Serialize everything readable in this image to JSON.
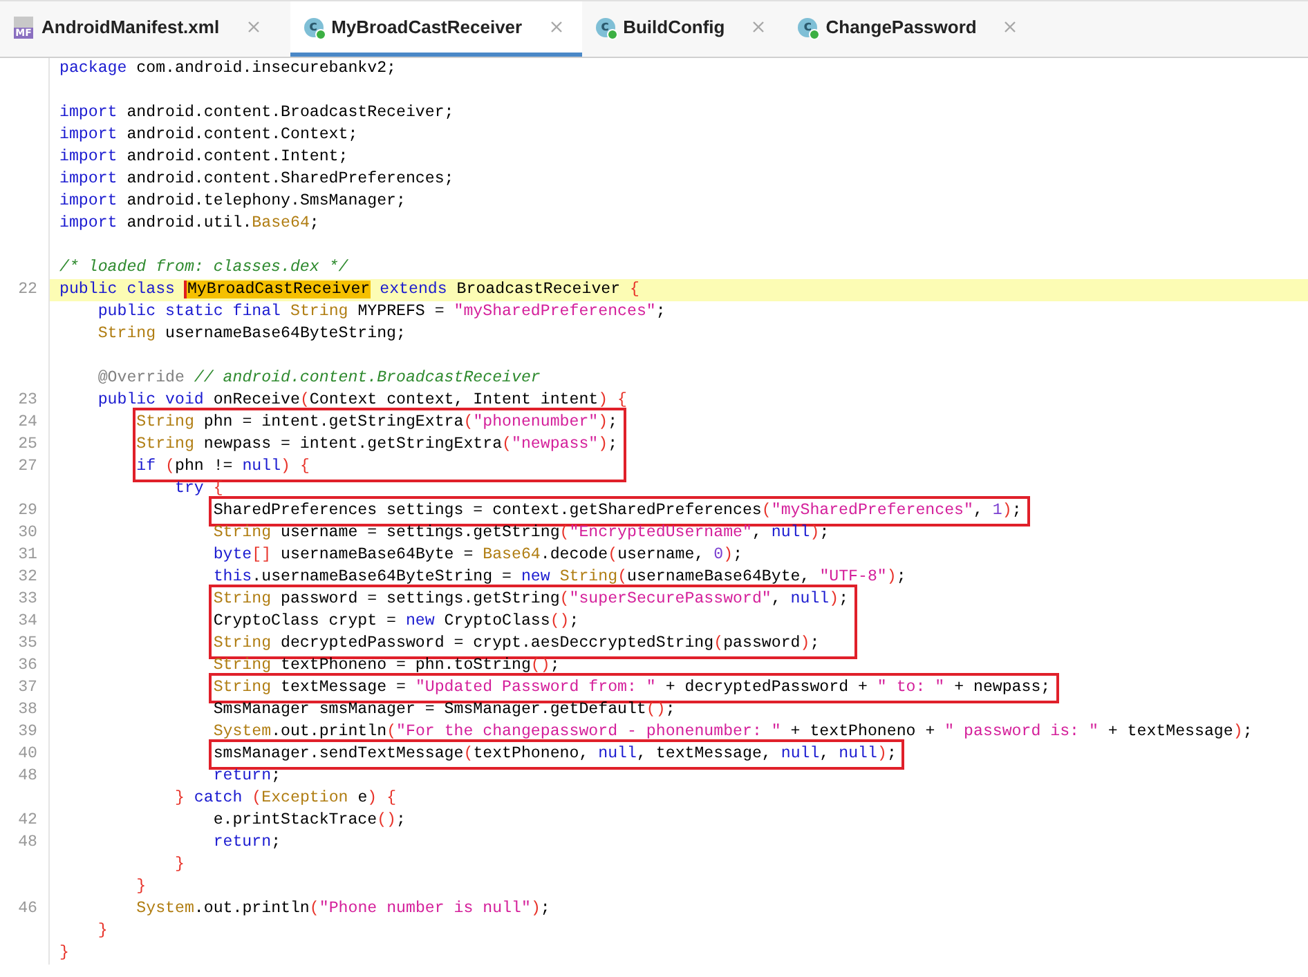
{
  "tabs": [
    {
      "label": "AndroidManifest.xml",
      "kind": "manifest",
      "icon_label": "MF",
      "selected": false
    },
    {
      "label": "MyBroadCastReceiver",
      "kind": "class",
      "icon_label": "c",
      "selected": true
    },
    {
      "label": "BuildConfig",
      "kind": "class",
      "icon_label": "c",
      "selected": false
    },
    {
      "label": "ChangePassword",
      "kind": "class",
      "icon_label": "c",
      "selected": false
    }
  ],
  "code": [
    {
      "kind": "line",
      "segments": [
        {
          "kind": "kw",
          "text": "package"
        },
        {
          "kind": "plain",
          "text": " com.android.insecurebankv2;"
        }
      ]
    },
    {
      "kind": "blank"
    },
    {
      "kind": "line",
      "segments": [
        {
          "kind": "kw",
          "text": "import"
        },
        {
          "kind": "plain",
          "text": " android.content.BroadcastReceiver;"
        }
      ]
    },
    {
      "kind": "line",
      "segments": [
        {
          "kind": "kw",
          "text": "import"
        },
        {
          "kind": "plain",
          "text": " android.content.Context;"
        }
      ]
    },
    {
      "kind": "line",
      "segments": [
        {
          "kind": "kw",
          "text": "import"
        },
        {
          "kind": "plain",
          "text": " android.content.Intent;"
        }
      ]
    },
    {
      "kind": "line",
      "segments": [
        {
          "kind": "kw",
          "text": "import"
        },
        {
          "kind": "plain",
          "text": " android.content.SharedPreferences;"
        }
      ]
    },
    {
      "kind": "line",
      "segments": [
        {
          "kind": "kw",
          "text": "import"
        },
        {
          "kind": "plain",
          "text": " android.telephony.SmsManager;"
        }
      ]
    },
    {
      "kind": "line",
      "segments": [
        {
          "kind": "kw",
          "text": "import"
        },
        {
          "kind": "plain",
          "text": " android.util."
        },
        {
          "kind": "type",
          "text": "Base64"
        },
        {
          "kind": "plain",
          "text": ";"
        }
      ]
    },
    {
      "kind": "blank"
    },
    {
      "kind": "line",
      "segments": [
        {
          "kind": "comment",
          "text": "/* loaded from: classes.dex */"
        }
      ]
    },
    {
      "kind": "line",
      "number": "22",
      "selected": true,
      "segments": [
        {
          "kind": "kw",
          "text": "public class "
        },
        {
          "kind": "selection",
          "text": "MyBroadCastReceiver"
        },
        {
          "kind": "kw",
          "text": " extends"
        },
        {
          "kind": "plain",
          "text": " BroadcastReceiver "
        },
        {
          "kind": "punc",
          "text": "{"
        }
      ],
      "children": [
        {
          "kind": "line",
          "segments": [
            {
              "kind": "kw",
              "text": "public static final "
            },
            {
              "kind": "type",
              "text": "String"
            },
            {
              "kind": "plain",
              "text": " MYPREFS = "
            },
            {
              "kind": "str",
              "text": "\"mySharedPreferences\""
            },
            {
              "kind": "plain",
              "text": ";"
            }
          ]
        },
        {
          "kind": "line",
          "segments": [
            {
              "kind": "type",
              "text": "String"
            },
            {
              "kind": "plain",
              "text": " usernameBase64ByteString;"
            }
          ]
        },
        {
          "kind": "blank"
        },
        {
          "kind": "line",
          "segments": [
            {
              "kind": "annotation",
              "text": "@Override "
            },
            {
              "kind": "comment",
              "text": "// android.content.BroadcastReceiver"
            }
          ]
        },
        {
          "kind": "line",
          "number": "23",
          "segments": [
            {
              "kind": "kw",
              "text": "public void"
            },
            {
              "kind": "plain",
              "text": " onReceive"
            },
            {
              "kind": "punc",
              "text": "("
            },
            {
              "kind": "plain",
              "text": "Context context, Intent intent"
            },
            {
              "kind": "punc",
              "text": ") {"
            }
          ],
          "children": [
            {
              "kind": "box",
              "lines": [
                {
                  "number": "24",
                  "segments": [
                    {
                      "kind": "type",
                      "text": "String"
                    },
                    {
                      "kind": "plain",
                      "text": " phn = intent.getStringExtra"
                    },
                    {
                      "kind": "punc",
                      "text": "("
                    },
                    {
                      "kind": "str",
                      "text": "\"phonenumber\""
                    },
                    {
                      "kind": "punc",
                      "text": ")"
                    },
                    {
                      "kind": "plain",
                      "text": ";"
                    }
                  ]
                },
                {
                  "number": "25",
                  "segments": [
                    {
                      "kind": "type",
                      "text": "String"
                    },
                    {
                      "kind": "plain",
                      "text": " newpass = intent.getStringExtra"
                    },
                    {
                      "kind": "punc",
                      "text": "("
                    },
                    {
                      "kind": "str",
                      "text": "\"newpass\""
                    },
                    {
                      "kind": "punc",
                      "text": ")"
                    },
                    {
                      "kind": "plain",
                      "text": ";"
                    }
                  ]
                },
                {
                  "number": "27",
                  "segments": [
                    {
                      "kind": "kw",
                      "text": "if "
                    },
                    {
                      "kind": "punc",
                      "text": "("
                    },
                    {
                      "kind": "plain",
                      "text": "phn != "
                    },
                    {
                      "kind": "kw",
                      "text": "null"
                    },
                    {
                      "kind": "punc",
                      "text": ") {"
                    }
                  ]
                }
              ],
              "children": [
                {
                  "kind": "line",
                  "segments": [
                    {
                      "kind": "kw",
                      "text": "try "
                    },
                    {
                      "kind": "punc",
                      "text": "{"
                    }
                  ],
                  "children": [
                    {
                      "kind": "box",
                      "lines": [
                        {
                          "number": "29",
                          "segments": [
                            {
                              "kind": "plain",
                              "text": "SharedPreferences settings = context.getSharedPreferences"
                            },
                            {
                              "kind": "punc",
                              "text": "("
                            },
                            {
                              "kind": "str",
                              "text": "\"mySharedPreferences\""
                            },
                            {
                              "kind": "plain",
                              "text": ", "
                            },
                            {
                              "kind": "num",
                              "text": "1"
                            },
                            {
                              "kind": "punc",
                              "text": ")"
                            },
                            {
                              "kind": "plain",
                              "text": ";"
                            }
                          ]
                        }
                      ]
                    },
                    {
                      "kind": "line",
                      "number": "30",
                      "segments": [
                        {
                          "kind": "type",
                          "text": "String"
                        },
                        {
                          "kind": "plain",
                          "text": " username = settings.getString"
                        },
                        {
                          "kind": "punc",
                          "text": "("
                        },
                        {
                          "kind": "str",
                          "text": "\"EncryptedUsername\""
                        },
                        {
                          "kind": "plain",
                          "text": ", "
                        },
                        {
                          "kind": "kw",
                          "text": "null"
                        },
                        {
                          "kind": "punc",
                          "text": ")"
                        },
                        {
                          "kind": "plain",
                          "text": ";"
                        }
                      ]
                    },
                    {
                      "kind": "line",
                      "number": "31",
                      "segments": [
                        {
                          "kind": "kw",
                          "text": "byte"
                        },
                        {
                          "kind": "punc",
                          "text": "[]"
                        },
                        {
                          "kind": "plain",
                          "text": " usernameBase64Byte = "
                        },
                        {
                          "kind": "type",
                          "text": "Base64"
                        },
                        {
                          "kind": "plain",
                          "text": ".decode"
                        },
                        {
                          "kind": "punc",
                          "text": "("
                        },
                        {
                          "kind": "plain",
                          "text": "username, "
                        },
                        {
                          "kind": "num",
                          "text": "0"
                        },
                        {
                          "kind": "punc",
                          "text": ")"
                        },
                        {
                          "kind": "plain",
                          "text": ";"
                        }
                      ]
                    },
                    {
                      "kind": "line",
                      "number": "32",
                      "segments": [
                        {
                          "kind": "kw",
                          "text": "this"
                        },
                        {
                          "kind": "plain",
                          "text": ".usernameBase64ByteString = "
                        },
                        {
                          "kind": "kw",
                          "text": "new "
                        },
                        {
                          "kind": "type",
                          "text": "String"
                        },
                        {
                          "kind": "punc",
                          "text": "("
                        },
                        {
                          "kind": "plain",
                          "text": "usernameBase64Byte, "
                        },
                        {
                          "kind": "str",
                          "text": "\"UTF-8\""
                        },
                        {
                          "kind": "punc",
                          "text": ")"
                        },
                        {
                          "kind": "plain",
                          "text": ";"
                        }
                      ]
                    },
                    {
                      "kind": "box",
                      "lines": [
                        {
                          "number": "33",
                          "segments": [
                            {
                              "kind": "type",
                              "text": "String"
                            },
                            {
                              "kind": "plain",
                              "text": " password = settings.getString"
                            },
                            {
                              "kind": "punc",
                              "text": "("
                            },
                            {
                              "kind": "str",
                              "text": "\"superSecurePassword\""
                            },
                            {
                              "kind": "plain",
                              "text": ", "
                            },
                            {
                              "kind": "kw",
                              "text": "null"
                            },
                            {
                              "kind": "punc",
                              "text": ")"
                            },
                            {
                              "kind": "plain",
                              "text": ";"
                            }
                          ]
                        },
                        {
                          "number": "34",
                          "segments": [
                            {
                              "kind": "plain",
                              "text": "CryptoClass crypt = "
                            },
                            {
                              "kind": "kw",
                              "text": "new"
                            },
                            {
                              "kind": "plain",
                              "text": " CryptoClass"
                            },
                            {
                              "kind": "punc",
                              "text": "()"
                            },
                            {
                              "kind": "plain",
                              "text": ";"
                            }
                          ]
                        },
                        {
                          "number": "35",
                          "segments": [
                            {
                              "kind": "type",
                              "text": "String"
                            },
                            {
                              "kind": "plain",
                              "text": " decryptedPassword = crypt.aesDeccryptedString"
                            },
                            {
                              "kind": "punc",
                              "text": "("
                            },
                            {
                              "kind": "plain",
                              "text": "password"
                            },
                            {
                              "kind": "punc",
                              "text": ")"
                            },
                            {
                              "kind": "plain",
                              "text": ";"
                            }
                          ]
                        }
                      ]
                    },
                    {
                      "kind": "line",
                      "number": "36",
                      "segments": [
                        {
                          "kind": "type",
                          "text": "String"
                        },
                        {
                          "kind": "plain",
                          "text": " textPhoneno = phn.toString"
                        },
                        {
                          "kind": "punc",
                          "text": "()"
                        },
                        {
                          "kind": "plain",
                          "text": ";"
                        }
                      ]
                    },
                    {
                      "kind": "box",
                      "lines": [
                        {
                          "number": "37",
                          "segments": [
                            {
                              "kind": "type",
                              "text": "String"
                            },
                            {
                              "kind": "plain",
                              "text": " textMessage = "
                            },
                            {
                              "kind": "str",
                              "text": "\"Updated Password from: \""
                            },
                            {
                              "kind": "plain",
                              "text": " + decryptedPassword + "
                            },
                            {
                              "kind": "str",
                              "text": "\" to: \""
                            },
                            {
                              "kind": "plain",
                              "text": " + newpass;"
                            }
                          ]
                        }
                      ]
                    },
                    {
                      "kind": "line",
                      "number": "38",
                      "segments": [
                        {
                          "kind": "plain",
                          "text": "SmsManager smsManager = SmsManager.getDefault"
                        },
                        {
                          "kind": "punc",
                          "text": "()"
                        },
                        {
                          "kind": "plain",
                          "text": ";"
                        }
                      ]
                    },
                    {
                      "kind": "line",
                      "number": "39",
                      "segments": [
                        {
                          "kind": "type",
                          "text": "System"
                        },
                        {
                          "kind": "plain",
                          "text": ".out.println"
                        },
                        {
                          "kind": "punc",
                          "text": "("
                        },
                        {
                          "kind": "str",
                          "text": "\"For the changepassword - phonenumber: \""
                        },
                        {
                          "kind": "plain",
                          "text": " + textPhoneno + "
                        },
                        {
                          "kind": "str",
                          "text": "\" password is: \""
                        },
                        {
                          "kind": "plain",
                          "text": " + textMessage"
                        },
                        {
                          "kind": "punc",
                          "text": ")"
                        },
                        {
                          "kind": "plain",
                          "text": ";"
                        }
                      ]
                    },
                    {
                      "kind": "box",
                      "lines": [
                        {
                          "number": "40",
                          "segments": [
                            {
                              "kind": "plain",
                              "text": "smsManager.sendTextMessage"
                            },
                            {
                              "kind": "punc",
                              "text": "("
                            },
                            {
                              "kind": "plain",
                              "text": "textPhoneno, "
                            },
                            {
                              "kind": "kw",
                              "text": "null"
                            },
                            {
                              "kind": "plain",
                              "text": ", textMessage, "
                            },
                            {
                              "kind": "kw",
                              "text": "null"
                            },
                            {
                              "kind": "plain",
                              "text": ", "
                            },
                            {
                              "kind": "kw",
                              "text": "null"
                            },
                            {
                              "kind": "punc",
                              "text": ")"
                            },
                            {
                              "kind": "plain",
                              "text": ";"
                            }
                          ]
                        }
                      ]
                    },
                    {
                      "kind": "line",
                      "number": "48",
                      "segments": [
                        {
                          "kind": "kw",
                          "text": "return"
                        },
                        {
                          "kind": "plain",
                          "text": ";"
                        }
                      ]
                    }
                  ]
                },
                {
                  "kind": "line",
                  "segments": [
                    {
                      "kind": "punc",
                      "text": "} "
                    },
                    {
                      "kind": "kw",
                      "text": "catch "
                    },
                    {
                      "kind": "punc",
                      "text": "("
                    },
                    {
                      "kind": "type",
                      "text": "Exception"
                    },
                    {
                      "kind": "plain",
                      "text": " e"
                    },
                    {
                      "kind": "punc",
                      "text": ") {"
                    }
                  ],
                  "children": [
                    {
                      "kind": "line",
                      "number": "42",
                      "segments": [
                        {
                          "kind": "plain",
                          "text": "e.printStackTrace"
                        },
                        {
                          "kind": "punc",
                          "text": "()"
                        },
                        {
                          "kind": "plain",
                          "text": ";"
                        }
                      ]
                    },
                    {
                      "kind": "line",
                      "number": "48",
                      "segments": [
                        {
                          "kind": "kw",
                          "text": "return"
                        },
                        {
                          "kind": "plain",
                          "text": ";"
                        }
                      ]
                    }
                  ]
                },
                {
                  "kind": "line",
                  "segments": [
                    {
                      "kind": "punc",
                      "text": "}"
                    }
                  ]
                }
              ]
            },
            {
              "kind": "line",
              "segments": [
                {
                  "kind": "punc",
                  "text": "}"
                }
              ]
            },
            {
              "kind": "line",
              "number": "46",
              "segments": [
                {
                  "kind": "type",
                  "text": "System"
                },
                {
                  "kind": "plain",
                  "text": ".out.println"
                },
                {
                  "kind": "punc",
                  "text": "("
                },
                {
                  "kind": "str",
                  "text": "\"Phone number is null\""
                },
                {
                  "kind": "punc",
                  "text": ")"
                },
                {
                  "kind": "plain",
                  "text": ";"
                }
              ]
            }
          ]
        },
        {
          "kind": "line",
          "segments": [
            {
              "kind": "punc",
              "text": "}"
            }
          ]
        }
      ]
    },
    {
      "kind": "line",
      "segments": [
        {
          "kind": "punc",
          "text": "}"
        }
      ]
    }
  ]
}
